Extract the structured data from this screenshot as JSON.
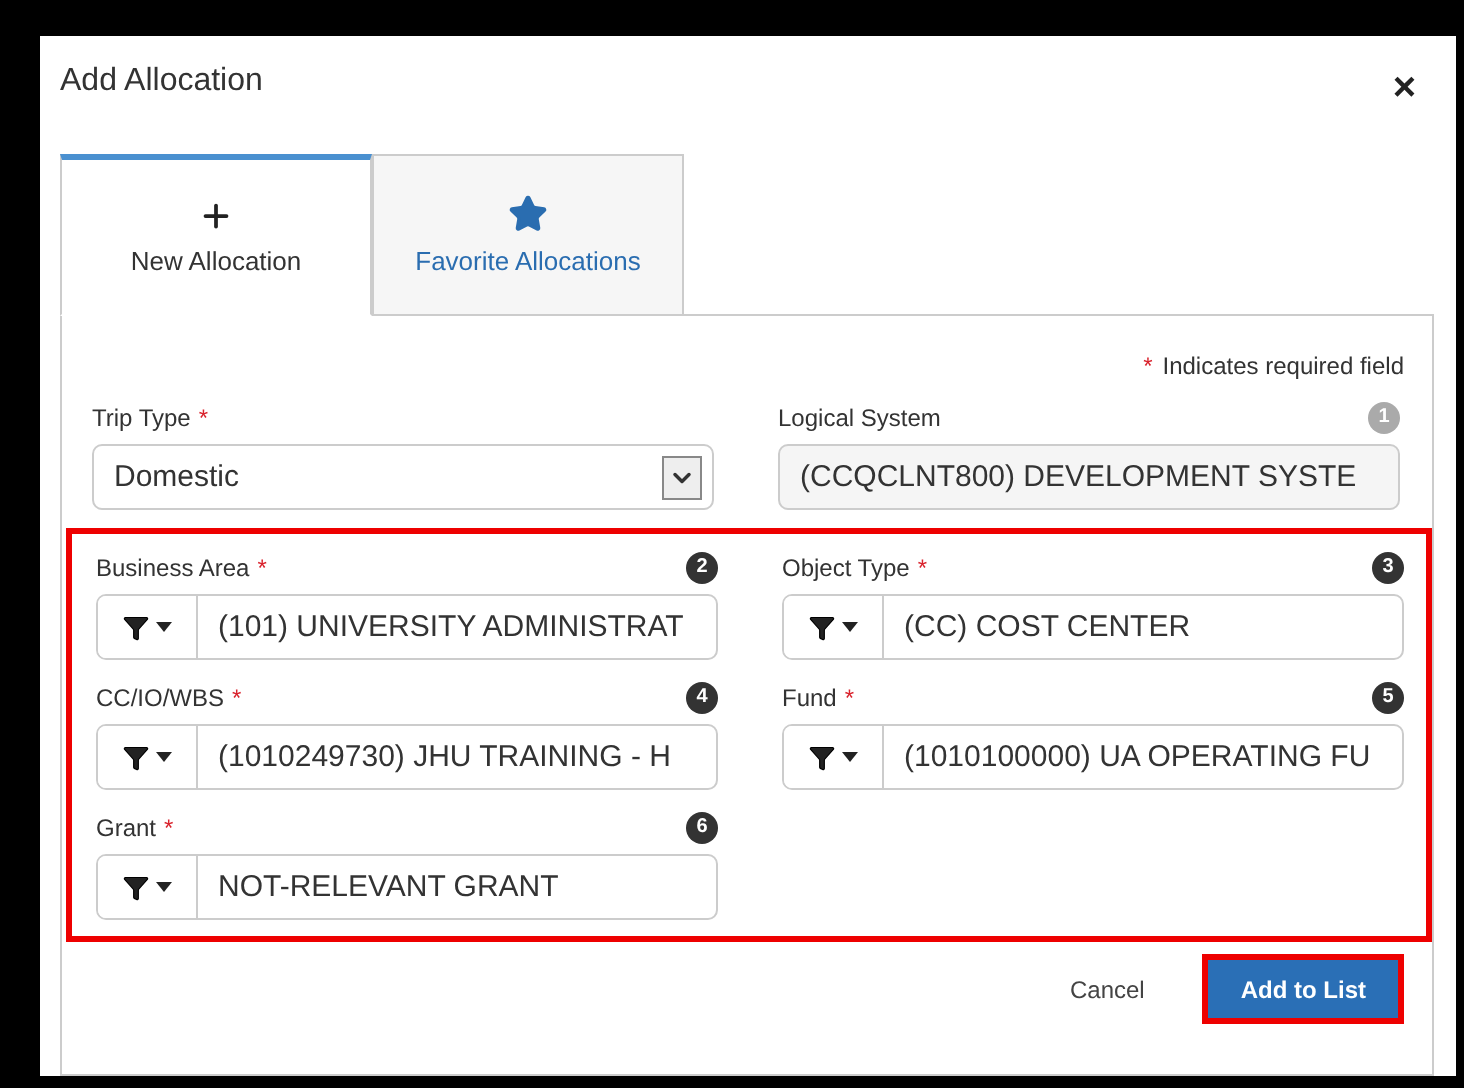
{
  "dialog": {
    "title": "Add Allocation",
    "close": "×"
  },
  "tabs": [
    {
      "kind": "plus",
      "label": "New Allocation",
      "selected": true
    },
    {
      "kind": "star",
      "label": "Favorite Allocations",
      "selected": false
    }
  ],
  "required_note": {
    "mark": "*",
    "text": "Indicates required field"
  },
  "fields": [
    {
      "label": "Trip Type",
      "required_mark": "*",
      "kind": "select",
      "value": "Domestic"
    },
    {
      "label": "Logical System",
      "kind": "readonly",
      "badge": "1",
      "value": "(CCQCLNT800) DEVELOPMENT SYSTE"
    }
  ],
  "highlight_frame": {
    "fields": [
      {
        "label": "Business Area",
        "required_mark": "*",
        "kind": "filter",
        "badge": "2",
        "value": "(101) UNIVERSITY ADMINISTRAT"
      },
      {
        "label": "Object Type",
        "required_mark": "*",
        "kind": "filter",
        "badge": "3",
        "value": "(CC) COST CENTER"
      },
      {
        "label": "CC/IO/WBS",
        "required_mark": "*",
        "kind": "filter",
        "badge": "4",
        "value": "(1010249730) JHU TRAINING - H"
      },
      {
        "label": "Fund",
        "required_mark": "*",
        "kind": "filter",
        "badge": "5",
        "value": "(1010100000) UA OPERATING FU"
      },
      {
        "label": "Grant",
        "required_mark": "*",
        "kind": "filter",
        "badge": "6",
        "value": "NOT-RELEVANT GRANT"
      }
    ]
  },
  "buttons": [
    {
      "label": "Cancel",
      "kind": "link",
      "highlighted": false
    },
    {
      "label": "Add to List",
      "kind": "primary",
      "highlighted": true
    }
  ]
}
